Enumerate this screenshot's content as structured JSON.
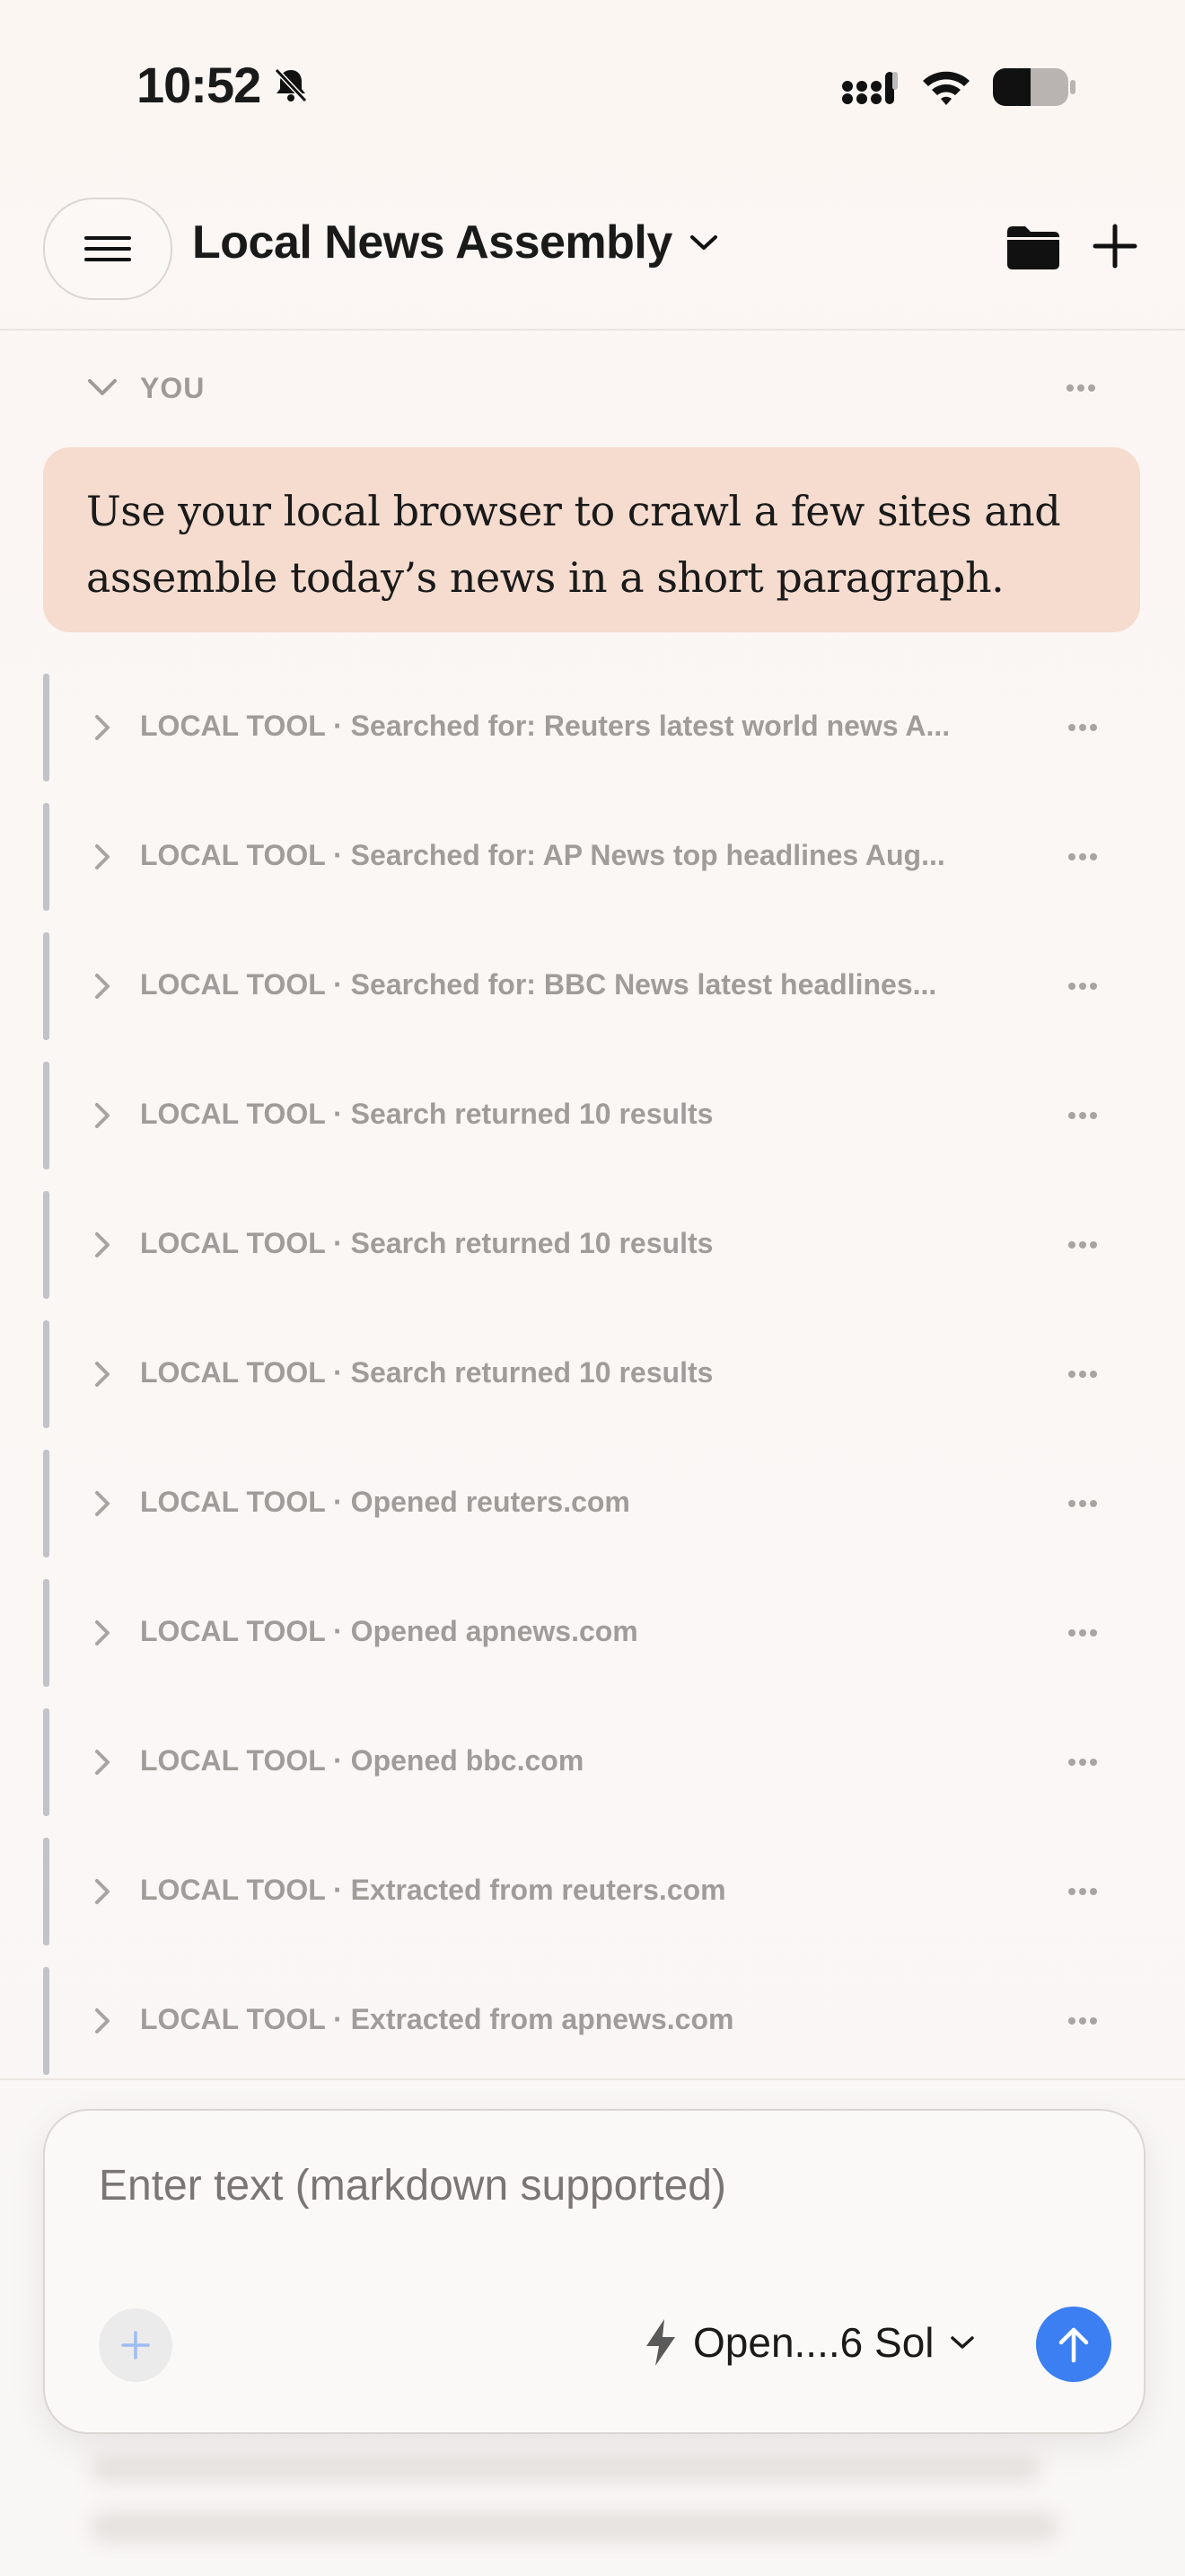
{
  "status_bar": {
    "time": "10:52"
  },
  "header": {
    "title": "Local News Assembly"
  },
  "section": {
    "label": "YOU"
  },
  "user_message": {
    "text_line1": "Use your local browser to crawl a few sites and",
    "text_line2": "assemble today’s news in a short paragraph."
  },
  "tool_rows": [
    {
      "text": "LOCAL TOOL · Searched for: Reuters latest world news A..."
    },
    {
      "text": "LOCAL TOOL · Searched for: AP News top headlines Aug..."
    },
    {
      "text": "LOCAL TOOL · Searched for: BBC News latest headlines..."
    },
    {
      "text": "LOCAL TOOL · Search returned 10 results"
    },
    {
      "text": "LOCAL TOOL · Search returned 10 results"
    },
    {
      "text": "LOCAL TOOL · Search returned 10 results"
    },
    {
      "text": "LOCAL TOOL · Opened reuters.com"
    },
    {
      "text": "LOCAL TOOL · Opened apnews.com"
    },
    {
      "text": "LOCAL TOOL · Opened bbc.com"
    },
    {
      "text": "LOCAL TOOL · Extracted from reuters.com"
    },
    {
      "text": "LOCAL TOOL · Extracted from apnews.com"
    }
  ],
  "composer": {
    "placeholder": "Enter text (markdown supported)",
    "model_label": "Open....6 Sol"
  },
  "colors": {
    "accent": "#3b7ff2",
    "bubble": "#f5dccf",
    "tool_bar": "#c1c3c9"
  },
  "icons": {
    "menu": "hamburger-icon",
    "title_dropdown": "chevron-down-icon",
    "folder": "folder-icon",
    "new": "plus-icon",
    "row_expand": "chevron-right-icon",
    "row_more": "more-dots-icon",
    "attach": "plus-icon",
    "model": "lightning-icon",
    "send": "arrow-up-icon"
  }
}
